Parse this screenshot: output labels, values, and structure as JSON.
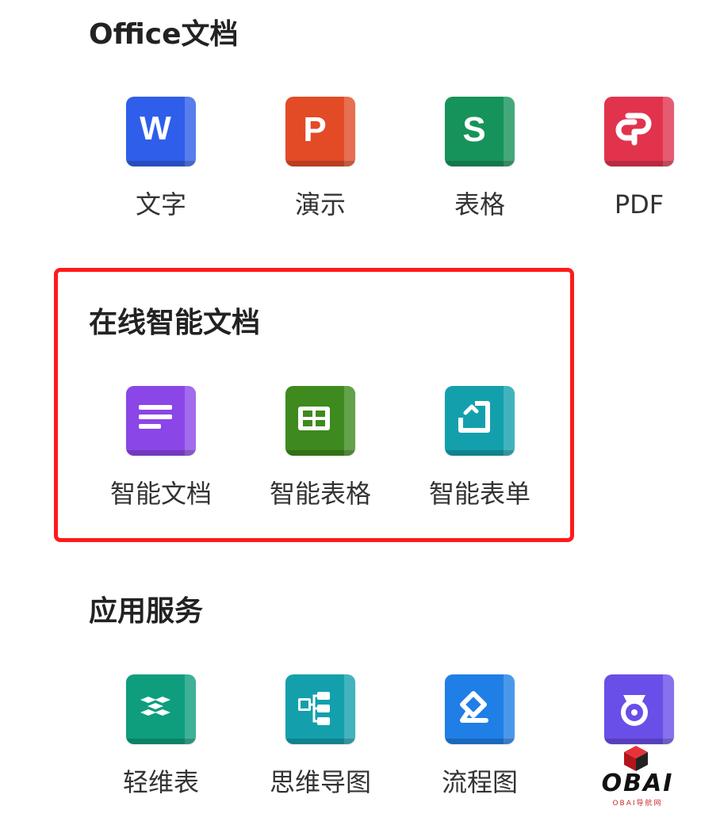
{
  "office": {
    "title": "Office文档",
    "apps": [
      {
        "label": "文字",
        "icon": "word-icon",
        "color": "#2f5eea",
        "letter": "W"
      },
      {
        "label": "演示",
        "icon": "presentation-icon",
        "color": "#e24b26",
        "letter": "P"
      },
      {
        "label": "表格",
        "icon": "spreadsheet-icon",
        "color": "#16935a",
        "letter": "S"
      },
      {
        "label": "PDF",
        "icon": "pdf-icon",
        "color": "#e2334d"
      }
    ]
  },
  "online": {
    "title": "在线智能文档",
    "apps": [
      {
        "label": "智能文档",
        "icon": "smart-doc-icon",
        "color": "#8b46e8"
      },
      {
        "label": "智能表格",
        "icon": "smart-sheet-icon",
        "color": "#3e8a1e"
      },
      {
        "label": "智能表单",
        "icon": "smart-form-icon",
        "color": "#13a0ac"
      }
    ],
    "highlight_color": "#ff1a1a"
  },
  "services": {
    "title": "应用服务",
    "apps": [
      {
        "label": "轻维表",
        "icon": "light-table-icon",
        "color": "#0e9e7e"
      },
      {
        "label": "思维导图",
        "icon": "mind-map-icon",
        "color": "#13a0ac"
      },
      {
        "label": "流程图",
        "icon": "flowchart-icon",
        "color": "#1f7fe6"
      },
      {
        "label": "",
        "icon": "app-service-icon",
        "color": "#6a4ee8"
      }
    ]
  },
  "watermark": {
    "name": "OBAI",
    "subtitle": "OBAI导航网"
  }
}
